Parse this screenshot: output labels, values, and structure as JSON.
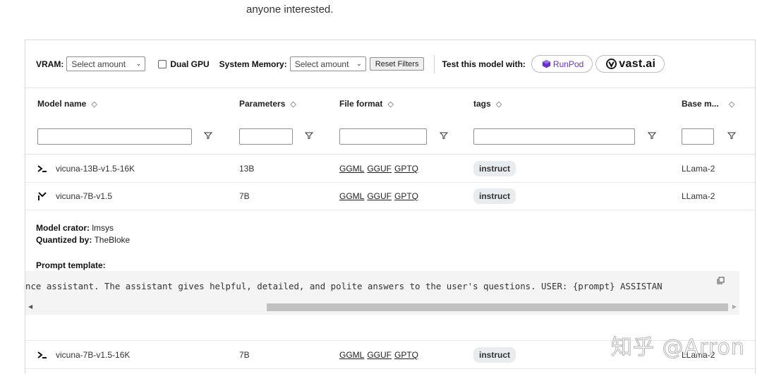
{
  "intro_text": "anyone interested.",
  "toolbar": {
    "vram_label": "VRAM:",
    "vram_select": "Select amount",
    "dual_gpu_label": "Dual GPU",
    "system_memory_label": "System Memory:",
    "system_memory_select": "Select amount",
    "reset_label": "Reset Filters",
    "test_label": "Test this model with:",
    "runpod_label": "RunPod",
    "vast_label": "vast.ai"
  },
  "columns": [
    {
      "label": "Model name"
    },
    {
      "label": "Parameters"
    },
    {
      "label": "File format"
    },
    {
      "label": "tags"
    },
    {
      "label": "Base m..."
    }
  ],
  "sort_icon": "◇",
  "rows": [
    {
      "icon": "terminal-icon",
      "name": "vicuna-13B-v1.5-16K",
      "params": "13B",
      "formats": [
        "GGML",
        "GGUF",
        "GPTQ"
      ],
      "tag": "instruct",
      "base": "LLama-2"
    },
    {
      "icon": "expanded-icon",
      "name": "vicuna-7B-v1.5",
      "params": "7B",
      "formats": [
        "GGML",
        "GGUF",
        "GPTQ"
      ],
      "tag": "instruct",
      "base": "LLama-2"
    },
    {
      "icon": "terminal-icon",
      "name": "vicuna-7B-v1.5-16K",
      "params": "7B",
      "formats": [
        "GGML",
        "GGUF",
        "GPTQ"
      ],
      "tag": "instruct",
      "base": "LLama-2"
    }
  ],
  "detail": {
    "creator_label": "Model crator:",
    "creator_value": "lmsys",
    "quantized_label": "Quantized by:",
    "quantized_value": "TheBloke",
    "prompt_label": "Prompt template:",
    "prompt_text": "nce assistant. The assistant gives helpful, detailed, and polite answers to the user's questions. USER: {prompt} ASSISTAN"
  },
  "watermark": "知乎 @Arron",
  "colors": {
    "runpod": "#6a32c9",
    "tag_bg": "#e9ecef",
    "code_bg": "#f4f4f4"
  }
}
